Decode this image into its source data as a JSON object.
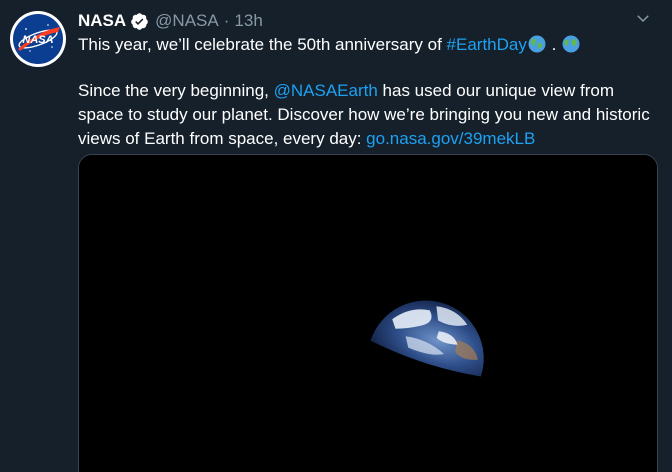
{
  "author": {
    "display_name": "NASA",
    "handle": "@NASA",
    "separator": "·",
    "timestamp": "13h",
    "verified": true,
    "avatar_icon": "nasa-meatball-logo",
    "avatar_logo_text": "NASA"
  },
  "tweet": {
    "line1_prefix": "This year, we’ll celebrate the 50th anniversary of ",
    "hashtag": "#EarthDay",
    "line1_mid": " . ",
    "para2_prefix": "Since the very beginning, ",
    "mention": "@NASAEarth",
    "para2_mid": " has used our unique view from space to study our planet. Discover how we’re bringing you new and historic views of Earth from space, every day: ",
    "url": "go.nasa.gov/39mekLB"
  },
  "media": {
    "icon": "earthrise-photo"
  },
  "icons": {
    "verified": "verified-badge-icon",
    "caret": "chevron-down-icon",
    "globe": "globe-emoji-icon"
  },
  "colors": {
    "background": "#15202b",
    "link": "#1da1f2",
    "muted": "#8899a6",
    "border": "#38444d"
  }
}
